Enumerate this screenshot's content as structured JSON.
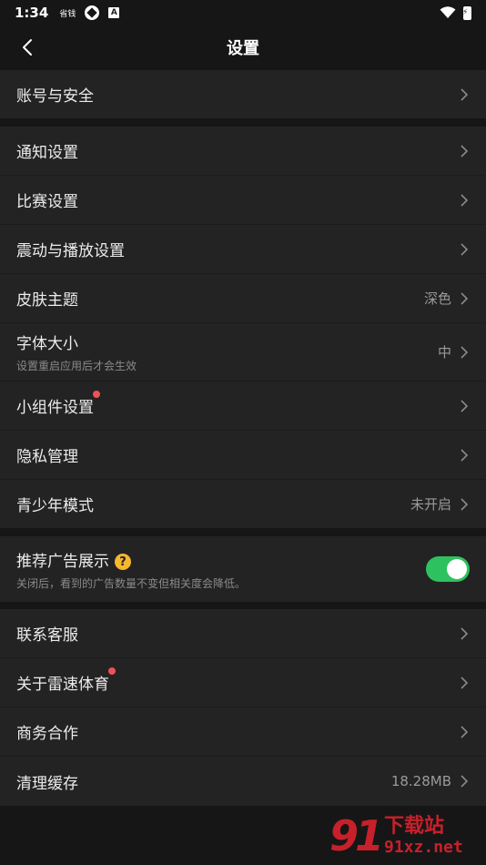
{
  "status_bar": {
    "time": "1:34",
    "mini_text": "省钱",
    "box_icon_text": "A"
  },
  "header": {
    "title": "设置"
  },
  "sections": {
    "account": {
      "label": "账号与安全"
    },
    "notify": {
      "label": "通知设置"
    },
    "match": {
      "label": "比赛设置"
    },
    "vibrate": {
      "label": "震动与播放设置"
    },
    "skin": {
      "label": "皮肤主题",
      "value": "深色"
    },
    "font": {
      "label": "字体大小",
      "sub": "设置重启应用后才会生效",
      "value": "中"
    },
    "widget": {
      "label": "小组件设置",
      "has_dot": true
    },
    "privacy": {
      "label": "隐私管理"
    },
    "youth": {
      "label": "青少年模式",
      "value": "未开启"
    },
    "ads": {
      "label": "推荐广告展示",
      "help": "?",
      "sub": "关闭后，看到的广告数量不变但相关度会降低。",
      "enabled": true
    },
    "support": {
      "label": "联系客服"
    },
    "about": {
      "label": "关于雷速体育",
      "has_dot": true
    },
    "business": {
      "label": "商务合作"
    },
    "cache": {
      "label": "清理缓存",
      "value": "18.28MB"
    }
  },
  "colors": {
    "background": "#161616",
    "row_background": "#232323",
    "toggle_on": "#2ec15f",
    "badge_dot": "#f0505a",
    "help_icon": "#f5b82e"
  },
  "watermark": {
    "logo": "91",
    "cn": "下载站",
    "url": "91xz.net"
  }
}
